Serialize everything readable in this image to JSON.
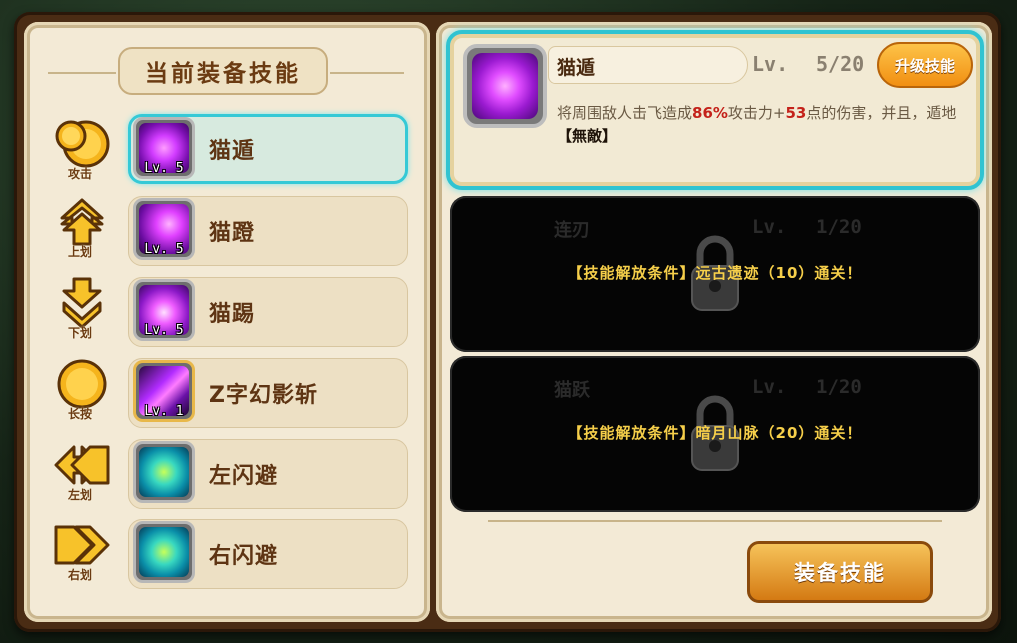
{
  "left": {
    "title": "当前装备技能",
    "keys": [
      {
        "label": "攻击",
        "icon": "attack-circle-icon"
      },
      {
        "label": "上划",
        "icon": "swipe-up-arrow-icon"
      },
      {
        "label": "下划",
        "icon": "swipe-down-arrow-icon"
      },
      {
        "label": "长按",
        "icon": "long-press-circle-icon"
      },
      {
        "label": "左划",
        "icon": "swipe-left-arrow-icon"
      },
      {
        "label": "右划",
        "icon": "swipe-right-arrow-icon"
      }
    ],
    "skills": [
      {
        "name": "猫遁",
        "level": "Lv. 5",
        "icon": "purple-vortex-icon"
      },
      {
        "name": "猫蹬",
        "level": "Lv. 5",
        "icon": "purple-kick-icon"
      },
      {
        "name": "猫踢",
        "level": "Lv. 5",
        "icon": "purple-burst-icon"
      },
      {
        "name": "Z字幻影斩",
        "level": "Lv. 1",
        "icon": "z-slash-icon"
      },
      {
        "name": "左闪避",
        "level": "",
        "icon": "dodge-left-icon"
      },
      {
        "name": "右闪避",
        "level": "",
        "icon": "dodge-right-icon"
      }
    ]
  },
  "selected": {
    "name": "猫遁",
    "lv_label": "Lv.",
    "lv_value": "5/20",
    "upgrade_label": "升级技能",
    "desc_part1": "将周围敌人击飞造成",
    "desc_pct": "86%",
    "desc_part2": "攻击力+",
    "desc_num": "53",
    "desc_part3": "点的伤害，并且，遁地",
    "desc_tag": "【無敵】"
  },
  "locked": [
    {
      "name": "连刃",
      "lv_label": "Lv.",
      "lv_value": "1/20",
      "condition": "【技能解放条件】远古遗迹（10）通关！"
    },
    {
      "name": "猫跃",
      "lv_label": "Lv.",
      "lv_value": "1/20",
      "condition": "【技能解放条件】暗月山脉（20）通关！"
    }
  ],
  "equip_label": "装备技能",
  "colors": {
    "accent_cyan": "#35c9d6",
    "button_orange": "#f18f12",
    "text_brown": "#5e3413",
    "condition_yellow": "#f6cf4a",
    "highlight_red": "#c4221a"
  }
}
